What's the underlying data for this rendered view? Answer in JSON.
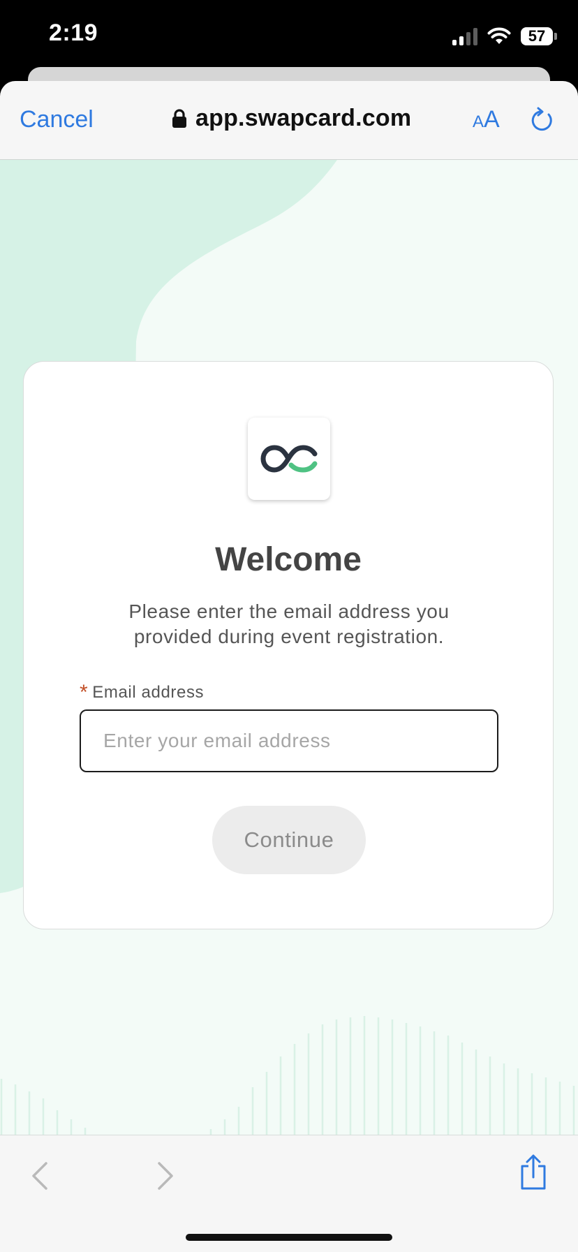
{
  "status_bar": {
    "time": "2:19",
    "battery": "57"
  },
  "browser": {
    "cancel_label": "Cancel",
    "url": "app.swapcard.com",
    "text_size_small": "A",
    "text_size_large": "A",
    "accent_color": "#2f7ae0"
  },
  "login_card": {
    "title": "Welcome",
    "subtitle": "Please enter the email address you provided during event registration.",
    "required_marker": "*",
    "email_label": "Email address",
    "email_placeholder": "Enter your email address",
    "email_value": "",
    "continue_label": "Continue"
  },
  "colors": {
    "page_background": "#f3fbf7",
    "blob": "#d6f2e6",
    "logo_dark": "#2b3340",
    "logo_green": "#4fc283",
    "required": "#c24f27"
  }
}
